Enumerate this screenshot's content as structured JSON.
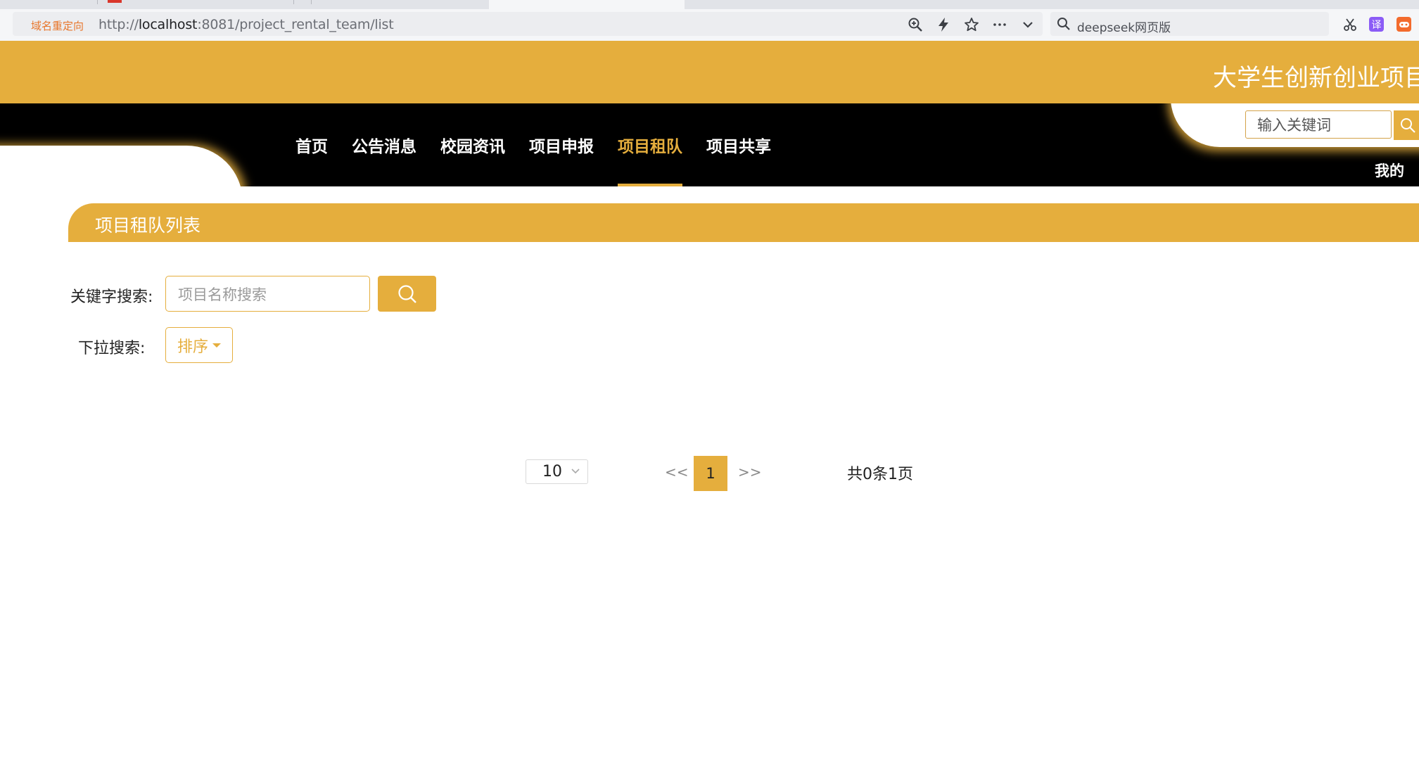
{
  "browser": {
    "redirect_tag": "域名重定向",
    "url_prefix": "http://",
    "url_host": "localhost",
    "url_rest": ":8081/project_rental_team/list",
    "search_text": "deepseek网页版",
    "icons": [
      "zoom-icon",
      "lightning-icon",
      "star-icon",
      "more-icon",
      "chevron-down-icon",
      "search-icon",
      "scissors-icon",
      "translate-icon",
      "game-icon"
    ],
    "translate_label": "译"
  },
  "site": {
    "title": "大学生创新创业项目管",
    "accent_color": "#e5ae3d",
    "nav": [
      {
        "label": "首页",
        "active": false
      },
      {
        "label": "公告消息",
        "active": false
      },
      {
        "label": "校园资讯",
        "active": false
      },
      {
        "label": "项目申报",
        "active": false
      },
      {
        "label": "项目租队",
        "active": true
      },
      {
        "label": "项目共享",
        "active": false
      }
    ],
    "search_placeholder": "输入关键词",
    "my_label": "我的"
  },
  "content": {
    "list_title": "项目租队列表",
    "keyword_label": "关键字搜索:",
    "keyword_placeholder": "项目名称搜索",
    "dropdown_label": "下拉搜索:",
    "sort_label": "排序"
  },
  "pagination": {
    "page_size": "10",
    "prev": "<<",
    "current_page": "1",
    "next": ">>",
    "total": "共0条1页"
  }
}
